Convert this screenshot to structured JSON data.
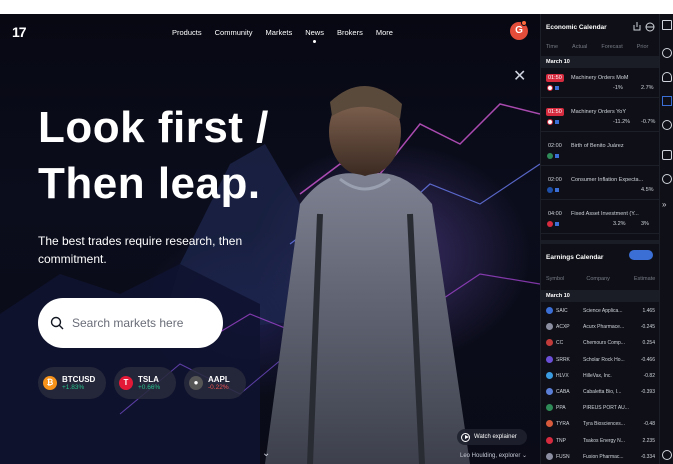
{
  "nav": {
    "logo": "17",
    "items": [
      "Products",
      "Community",
      "Markets",
      "News",
      "Brokers",
      "More"
    ],
    "avatar_letter": "G"
  },
  "hero": {
    "headline_line1": "Look first /",
    "headline_line2": "Then leap.",
    "subtitle": "The best trades require research, then commitment.",
    "search_placeholder": "Search markets here",
    "tickers": [
      {
        "symbol": "BTCUSD",
        "change": "+1.83%",
        "icon": "bitcoin-icon",
        "color": "#f7931a"
      },
      {
        "symbol": "TSLA",
        "change": "+0.66%",
        "icon": "tesla-icon",
        "color": "#e31937"
      },
      {
        "symbol": "AAPL",
        "change": "-0.22%",
        "icon": "apple-icon",
        "color": "#555555"
      }
    ],
    "watch_label": "Watch explainer",
    "credit": "Leo Houlding, explorer"
  },
  "economic": {
    "title": "Economic Calendar",
    "columns": [
      "Time",
      "Actual",
      "Forecast",
      "Prior"
    ],
    "date": "March 10",
    "events": [
      {
        "time": "01:50",
        "name": "Machinery Orders MoM",
        "v1": "-1%",
        "v2": "2.7%",
        "red": true,
        "flag": "#ffffff"
      },
      {
        "time": "01:50",
        "name": "Machinery Orders YoY",
        "v1": "-11.2%",
        "v2": "-0.7%",
        "red": true,
        "flag": "#ffffff"
      },
      {
        "time": "02:00",
        "name": "Birth of Benito Juárez",
        "v1": "",
        "v2": "",
        "red": false,
        "flag": "#2e8b57"
      },
      {
        "time": "02:00",
        "name": "Consumer Inflation Expecta...",
        "v1": "",
        "v2": "4.5%",
        "red": false,
        "flag": "#1e4fa8"
      },
      {
        "time": "04:00",
        "name": "Fixed Asset Investment (Y...",
        "v1": "3.2%",
        "v2": "3%",
        "red": false,
        "flag": "#d62b3f"
      }
    ]
  },
  "earnings": {
    "title": "Earnings Calendar",
    "columns": [
      "Symbol",
      "Company",
      "Estimate"
    ],
    "date": "March 10",
    "rows": [
      {
        "symbol": "SAIC",
        "company": "Science Applica...",
        "estimate": "1.465"
      },
      {
        "symbol": "ACXP",
        "company": "Acurx Pharmace...",
        "estimate": "-0.245"
      },
      {
        "symbol": "CC",
        "company": "Chemours Comp...",
        "estimate": "0.254"
      },
      {
        "symbol": "SRRK",
        "company": "Scholar Rock Ho...",
        "estimate": "-0.466"
      },
      {
        "symbol": "HLVX",
        "company": "HilleVax, Inc.",
        "estimate": "-0.82"
      },
      {
        "symbol": "CABA",
        "company": "Cabaletta Bio, I...",
        "estimate": "-0.393"
      },
      {
        "symbol": "PPA",
        "company": "PIREUS PORT AU...",
        "estimate": ""
      },
      {
        "symbol": "TYRA",
        "company": "Tyra Biosciences...",
        "estimate": "-0.48"
      },
      {
        "symbol": "TNP",
        "company": "Tsakos Energy N...",
        "estimate": "2.235"
      },
      {
        "symbol": "FUSN",
        "company": "Fusion Pharmac...",
        "estimate": "-0.334"
      }
    ]
  }
}
